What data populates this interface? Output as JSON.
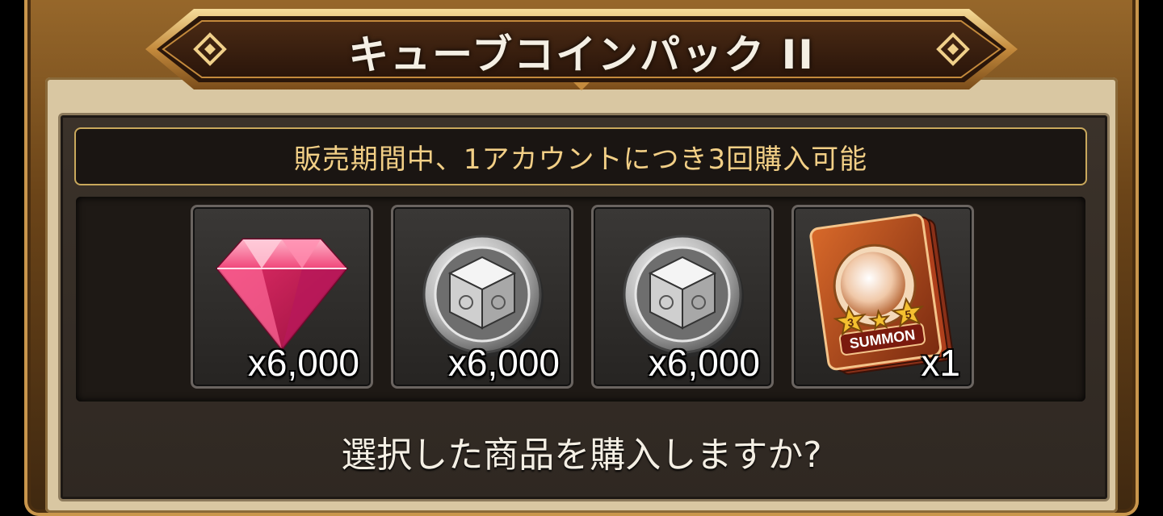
{
  "dialog": {
    "title": "キューブコインパック II",
    "notice": "販売期間中、1アカウントにつき3回購入可能",
    "confirm_prompt": "選択した商品を購入しますか?"
  },
  "items": [
    {
      "icon": "ruby-gem-icon",
      "quantity": "x6,000"
    },
    {
      "icon": "cube-coin-icon",
      "quantity": "x6,000"
    },
    {
      "icon": "cube-coin-icon",
      "quantity": "x6,000"
    },
    {
      "icon": "summon-ticket-icon",
      "quantity": "x1",
      "ticket_label": "SUMMON",
      "star_left": "3",
      "star_right": "5"
    }
  ],
  "colors": {
    "frame_gold": "#c9964c",
    "notice_text": "#f2cf86",
    "panel_bg": "#2f2822"
  }
}
